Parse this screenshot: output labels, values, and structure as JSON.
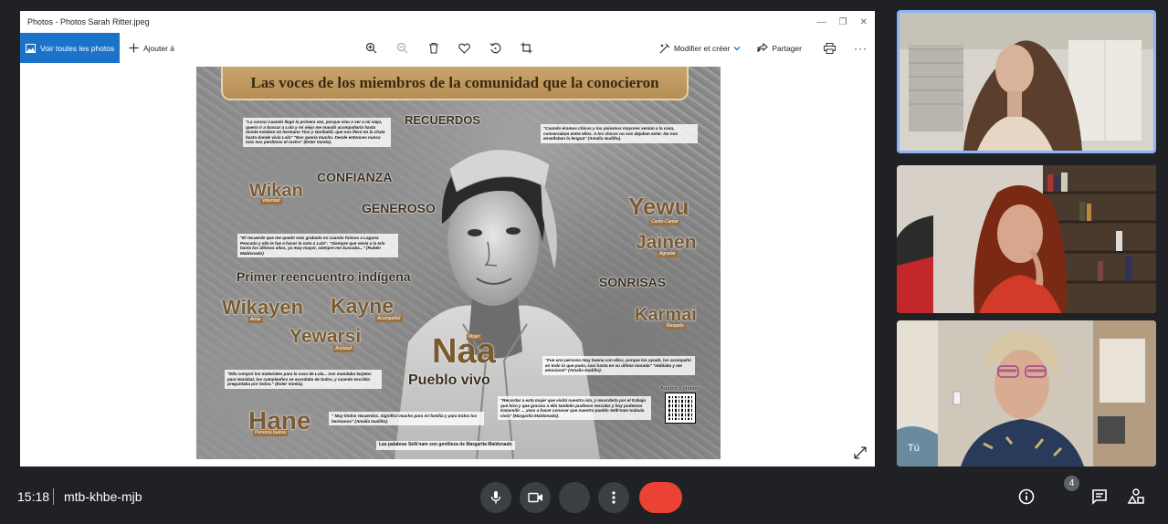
{
  "window": {
    "title": "Photos - Photos Sarah Ritter.jpeg"
  },
  "toolbar": {
    "see_all_label": "Voir toutes les photos",
    "add_label": "Ajouter à",
    "edit_label": "Modifier et créer",
    "share_label": "Partager",
    "tool_icons": [
      "zoom-in-icon",
      "zoom-out-icon",
      "trash-icon",
      "heart-icon",
      "rotate-icon",
      "crop-icon"
    ]
  },
  "poster": {
    "banner": "Las voces de los miembros de la comunidad que la conocieron",
    "words": {
      "recuerdos": "RECUERDOS",
      "confianza": "CONFIANZA",
      "wikan": "Wikan",
      "wikan_sub": "Voluntad",
      "generoso": "GENEROSO",
      "yewu": "Yewu",
      "yewu_sub": "Canto-Cantar",
      "jainen": "Jainen",
      "jainen_sub": "Agradar",
      "primer": "Primer reencuentro indígena",
      "sonrisas": "SONRISAS",
      "wikayen": "Wikayen",
      "wikayen_sub": "Amar",
      "kayne": "Kayne",
      "kayne_sub": "Acompañar",
      "karmai": "Karmai",
      "karmai_sub": "Respeto",
      "yewarsi": "Yewarsi",
      "yewarsi_sub": "Amistad",
      "naa": "Naa",
      "naa_sub": "Mujer",
      "pueblo": "Pueblo vivo",
      "hane": "Hane",
      "hane_sub": "Persona buena",
      "audios": "Audios y videos",
      "credit": "Las palabras Selk'nam son gentileza de Margarita Maldonado"
    },
    "quotes": {
      "q1": "\"La conocí cuando llegó la primera vez, porque vino a ver a mi viejo, quería ir a buscar a Lola y mi viejo me mandó acompañarla hasta donde estaban mi hermano Tino y Garibaldi, que nos llevó en la chata hasta donde vivía Lola\" \"Nos quería mucho. Desde entonces nunca más nos perdimos el rastro\" (Ester Varela).",
      "q2": "\"Cuando éramos chicos y los paisanos mayores venían a la casa, conversaban entre ellos. A los chicos no nos dejaban estar. No nos enseñaban la lengua\" (Amalia Gudiño).",
      "q3": "\"El recuerdo que me quedó más grabado es cuando fuimos a Laguna Pescado y ella le fue a hacer la nota a Lola\". \"Siempre que venía a la Isla hasta los últimos años, ya muy mayor, siempre me buscaba...\" (Rubén Maldonado)",
      "q4": "\"Ella compró los materiales para la casa de Lola... nos mandaba tarjetas para Navidad, los cumpleaños se acordaba de todos, y cuando escribía preguntaba por todos.\" (Ester Varela).",
      "q5": "\"Fue una persona muy buena con ellos, porque los ayudó, los acompañó en todo lo que pudo, casi hasta en su última morada\" \"Hablaba y me emocionó\" (Amalia Gudiño).",
      "q6": "\"Recordar a esta mujer que visitó nuestra isla, y recordarla por el trabajo que hizo y que gracias a ella también pudimos rescatar y hoy podemos transmitir ... ¡mas a hacer conocer que nuestro pueblo Selk'nam todavía vivía\" (Margarita Maldonado).",
      "q7": "\" Muy lindos recuerdos. Significó mucho para mi familia y para todos los hermanos\" (Amalia Gudiño)."
    }
  },
  "participants": [
    {
      "name": "participant-1"
    },
    {
      "name": "participant-2"
    },
    {
      "name": "participant-3",
      "label": "Tú"
    }
  ],
  "meeting": {
    "time": "15:18",
    "separator": "|",
    "code": "mtb-khbe-mjb",
    "participants_count": "4"
  },
  "colors": {
    "accent": "#1a73c9",
    "end_call": "#ea4335",
    "control_bg": "#3c4043",
    "active_tile_border": "#8ab4f8",
    "poster_brown": "#7a5a30"
  }
}
